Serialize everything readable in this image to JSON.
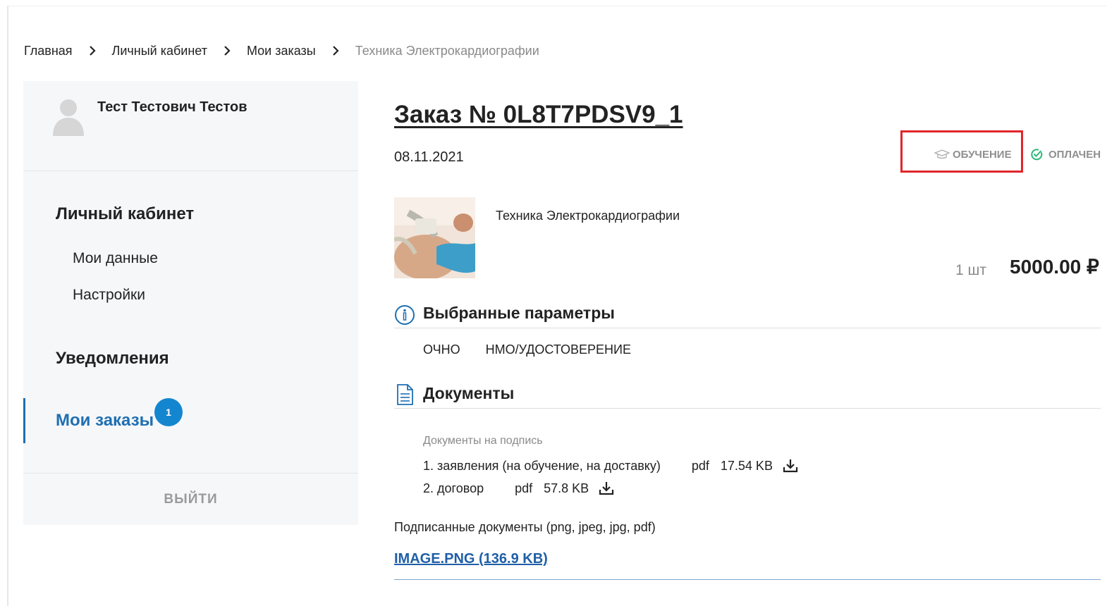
{
  "breadcrumb": {
    "items": [
      "Главная",
      "Личный кабинет",
      "Мои заказы",
      "Техника Электрокардиографии"
    ]
  },
  "sidebar": {
    "user_name": "Тест Тестович Тестов",
    "sections": [
      {
        "heading": "Личный кабинет",
        "items": [
          "Мои данные",
          "Настройки"
        ]
      },
      {
        "heading": "Уведомления",
        "items": []
      }
    ],
    "active_item": {
      "label": "Мои заказы",
      "badge": "1"
    },
    "logout_label": "ВЫЙТИ"
  },
  "order": {
    "title": "Заказ № 0L8T7PDSV9_1",
    "date": "08.11.2021",
    "status_education": "ОБУЧЕНИЕ",
    "status_paid": "ОПЛАЧЕН",
    "product_name": "Техника Электрокардиографии",
    "quantity": "1 шт",
    "price": "5000.00 ₽"
  },
  "params": {
    "title": "Выбранные параметры",
    "values": [
      "ОЧНО",
      "НМО/УДОСТОВЕРЕНИЕ"
    ]
  },
  "documents": {
    "title": "Документы",
    "subtitle": "Документы на подпись",
    "files": [
      {
        "name": "1. заявления (на обучение, на доставку)",
        "ext": "pdf",
        "size": "17.54 KB"
      },
      {
        "name": "2. договор",
        "ext": "pdf",
        "size": "57.8 KB"
      }
    ],
    "signed_label": "Подписанные документы (png, jpeg, jpg, pdf)",
    "signed_file": "IMAGE.PNG (136.9 KB)"
  },
  "colors": {
    "accent": "#1f6fb2",
    "badge": "#1486d0",
    "paid_check": "#2db87a",
    "highlight_box": "#e0262a"
  }
}
